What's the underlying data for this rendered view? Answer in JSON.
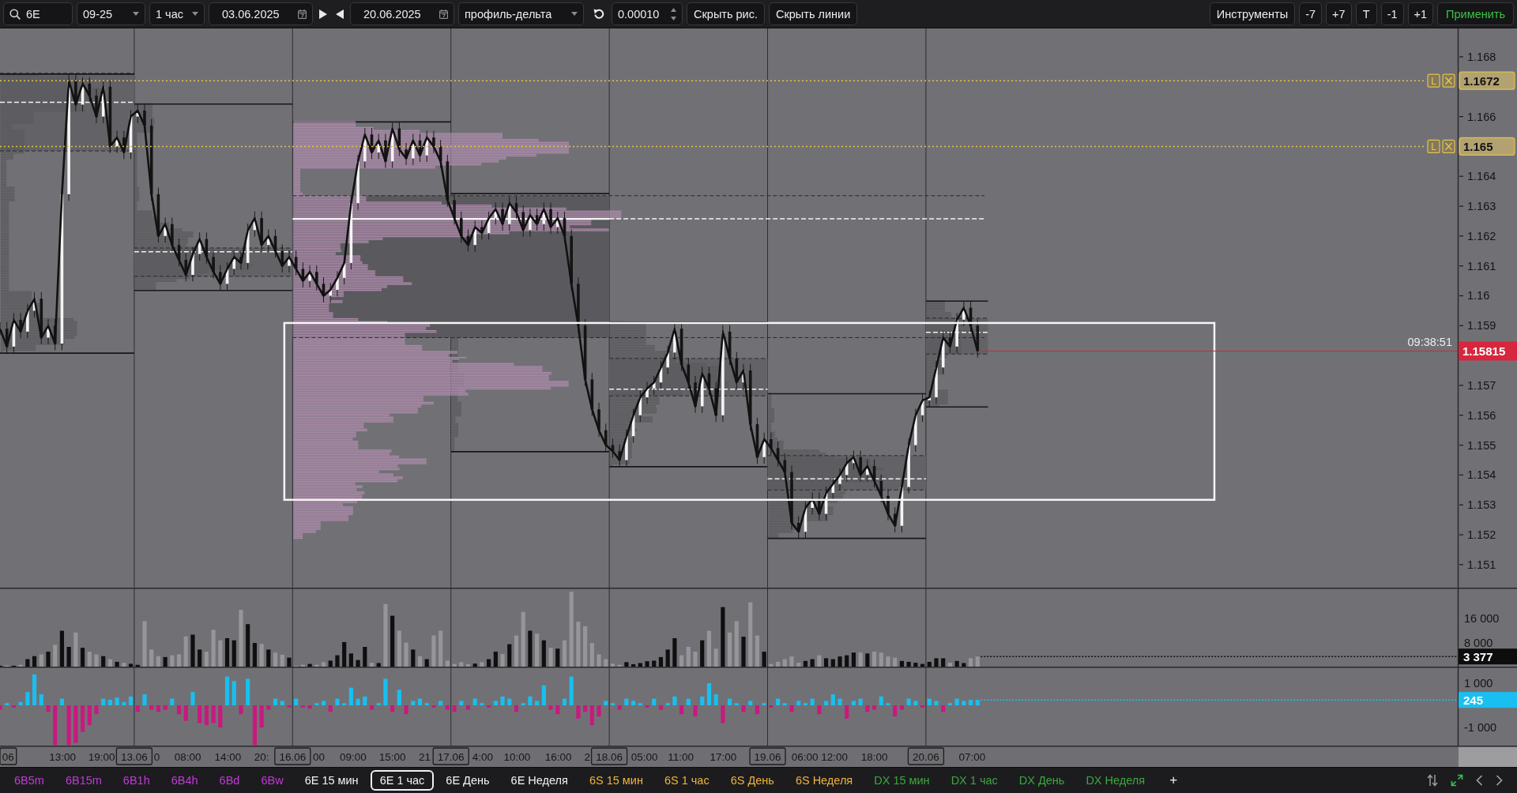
{
  "toolbar": {
    "search": {
      "value": "6E"
    },
    "contract": {
      "value": "09-25"
    },
    "timeframe": {
      "value": "1 час"
    },
    "date_from": {
      "value": "03.06.2025"
    },
    "date_to": {
      "value": "20.06.2025"
    },
    "mode": {
      "value": "профиль-дельта"
    },
    "step": {
      "value": "0.00010"
    },
    "buttons": [
      {
        "label": "Скрыть рис."
      },
      {
        "label": "Скрыть линии"
      }
    ],
    "right_buttons": [
      {
        "label": "Инструменты",
        "kind": "menu"
      },
      {
        "label": "-7",
        "kind": "step"
      },
      {
        "label": "+7",
        "kind": "step"
      },
      {
        "label": "T",
        "kind": "step"
      },
      {
        "label": "-1",
        "kind": "step"
      },
      {
        "label": "+1",
        "kind": "step"
      },
      {
        "label": "Применить",
        "kind": "apply"
      }
    ]
  },
  "price_panel": {
    "axis_labels": [
      "1.168",
      "1.166",
      "1.164",
      "1.163",
      "1.162",
      "1.161",
      "1.16",
      "1.159",
      "1.157",
      "1.156",
      "1.155",
      "1.154",
      "1.153",
      "1.152",
      "1.151"
    ],
    "levels": [
      {
        "label": "1.1672",
        "tag": "L"
      },
      {
        "label": "1.165",
        "tag": "L"
      }
    ],
    "current_price": {
      "label": "1.15815",
      "time": "09:38:51"
    }
  },
  "volume_panel": {
    "axis_labels": [
      "16 000",
      "8 000"
    ],
    "reading": "3 377"
  },
  "delta_panel": {
    "axis_labels": [
      "1 000",
      "-1 000"
    ],
    "reading": "245"
  },
  "time_axis": {
    "labels": [
      "13:00",
      "19:00",
      "0",
      "08:00",
      "14:00",
      "20:",
      "00",
      "09:00",
      "15:00",
      "21",
      "4:00",
      "10:00",
      "16:00",
      "2",
      "05:00",
      "11:00",
      "17:00",
      "06:00",
      "12:00",
      "18:00",
      "07:00"
    ],
    "dates": [
      "06",
      "13.06",
      "16.06",
      "17.06",
      "18.06",
      "19.06",
      "20.06"
    ]
  },
  "tabs": [
    {
      "label": "6B5m",
      "color": "#c23ad6",
      "selected": false
    },
    {
      "label": "6B15m",
      "color": "#c23ad6",
      "selected": false
    },
    {
      "label": "6B1h",
      "color": "#c23ad6",
      "selected": false
    },
    {
      "label": "6B4h",
      "color": "#c23ad6",
      "selected": false
    },
    {
      "label": "6Bd",
      "color": "#c23ad6",
      "selected": false
    },
    {
      "label": "6Bw",
      "color": "#c23ad6",
      "selected": false
    },
    {
      "label": "6E 15 мин",
      "color": "#f2f2f2",
      "selected": false
    },
    {
      "label": "6E 1 час",
      "color": "#f2f2f2",
      "selected": true
    },
    {
      "label": "6E День",
      "color": "#f2f2f2",
      "selected": false
    },
    {
      "label": "6E Неделя",
      "color": "#f2f2f2",
      "selected": false
    },
    {
      "label": "6S 15 мин",
      "color": "#f0b43a",
      "selected": false
    },
    {
      "label": "6S 1 час",
      "color": "#f0b43a",
      "selected": false
    },
    {
      "label": "6S День",
      "color": "#f0b43a",
      "selected": false
    },
    {
      "label": "6S Неделя",
      "color": "#f0b43a",
      "selected": false
    },
    {
      "label": "DX 15 мин",
      "color": "#3ca83c",
      "selected": false
    },
    {
      "label": "DX 1 час",
      "color": "#3ca83c",
      "selected": false
    },
    {
      "label": "DX День",
      "color": "#3ca83c",
      "selected": false
    },
    {
      "label": "DX Неделя",
      "color": "#3ca83c",
      "selected": false
    }
  ],
  "add_tab": "+"
}
